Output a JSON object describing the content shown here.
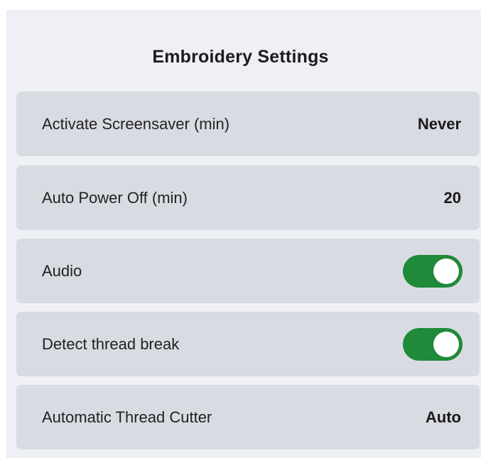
{
  "header": {
    "title": "Embroidery Settings"
  },
  "settings": [
    {
      "label": "Activate Screensaver (min)",
      "value": "Never"
    },
    {
      "label": "Auto Power Off (min)",
      "value": "20"
    },
    {
      "label": "Audio",
      "toggle_on": true
    },
    {
      "label": "Detect thread break",
      "toggle_on": true
    },
    {
      "label": "Automatic Thread Cutter",
      "value": "Auto"
    }
  ],
  "colors": {
    "panel_background": "#eef0f6",
    "row_background": "#d9dbe3",
    "toggle_on": "#1f8a3a"
  }
}
